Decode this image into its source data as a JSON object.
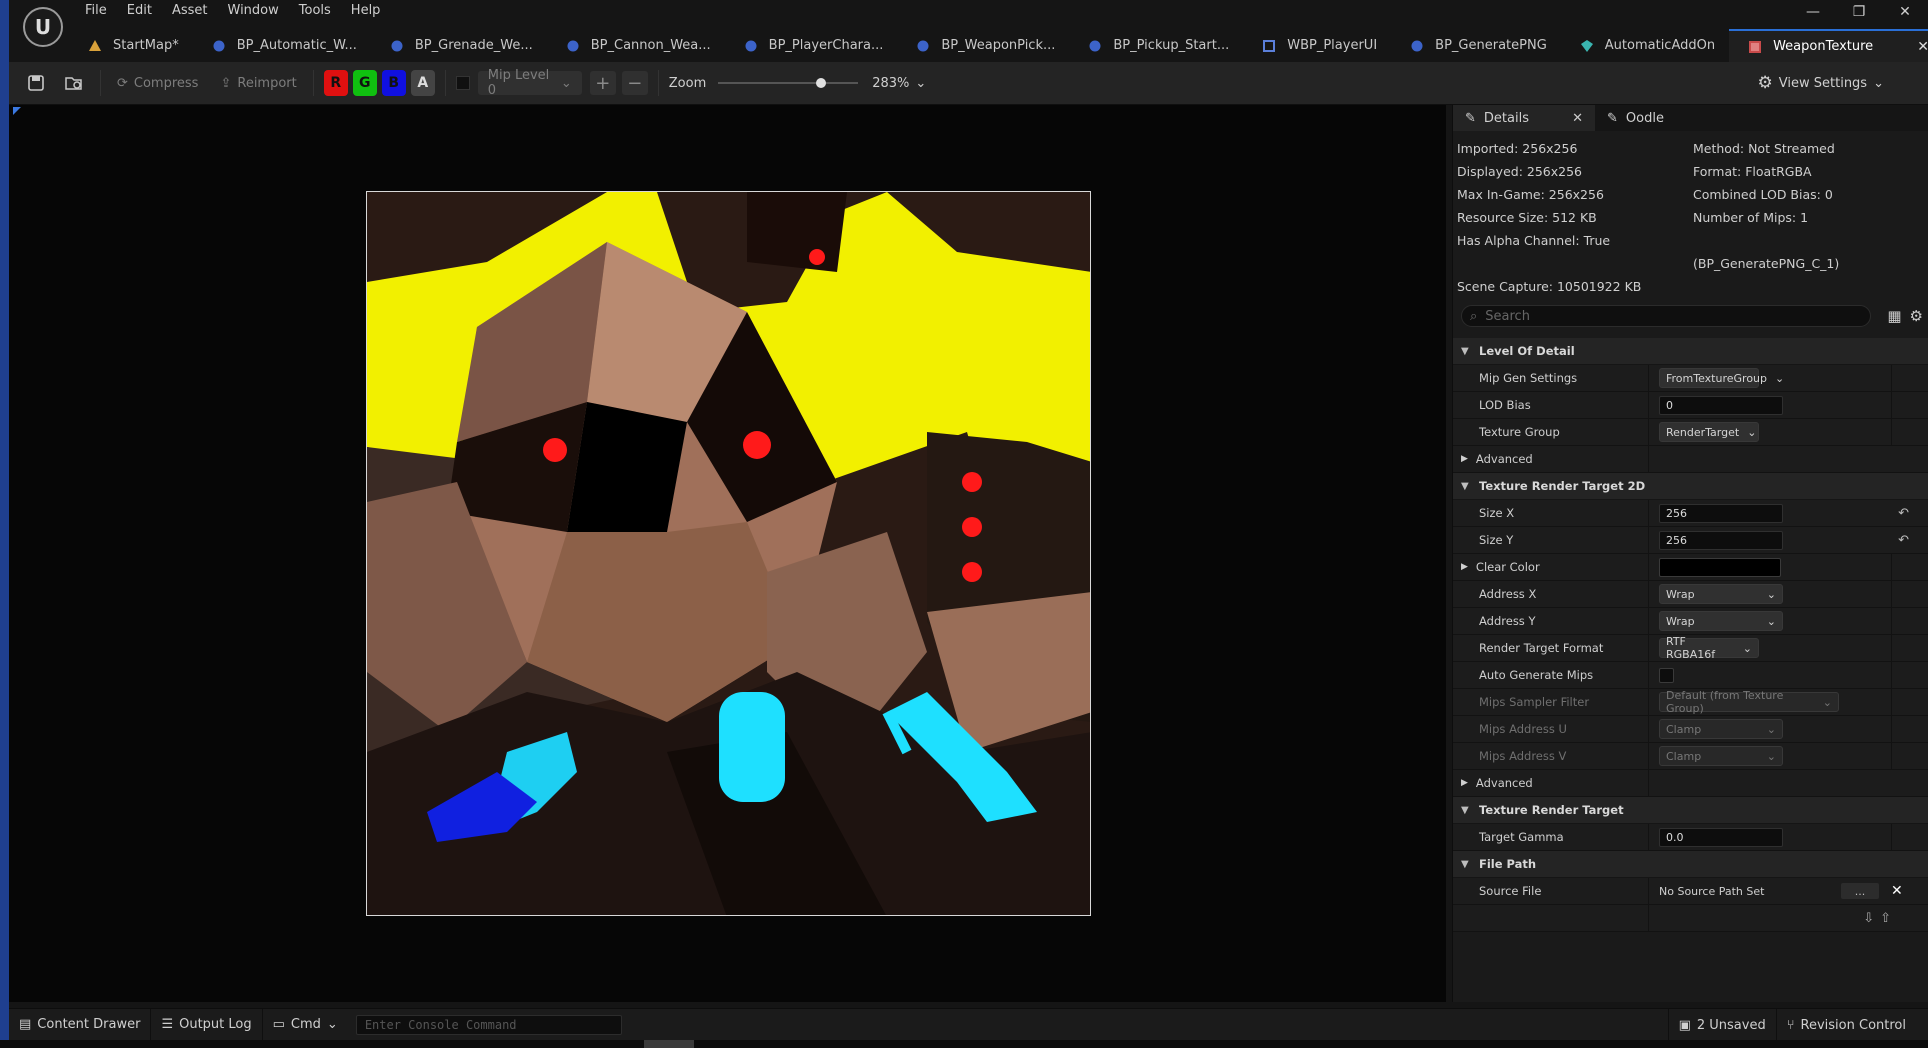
{
  "menu": [
    "File",
    "Edit",
    "Asset",
    "Window",
    "Tools",
    "Help"
  ],
  "window_controls": [
    "—",
    "❐",
    "✕"
  ],
  "tabs": [
    {
      "label": "StartMap*",
      "icon": "map-icon"
    },
    {
      "label": "BP_Automatic_W...",
      "icon": "blueprint-icon"
    },
    {
      "label": "BP_Grenade_We...",
      "icon": "blueprint-icon"
    },
    {
      "label": "BP_Cannon_Wea...",
      "icon": "blueprint-icon"
    },
    {
      "label": "BP_PlayerChara...",
      "icon": "blueprint-icon"
    },
    {
      "label": "BP_WeaponPick...",
      "icon": "blueprint-icon"
    },
    {
      "label": "BP_Pickup_Start...",
      "icon": "blueprint-icon"
    },
    {
      "label": "WBP_PlayerUI",
      "icon": "widget-blueprint-icon"
    },
    {
      "label": "BP_GeneratePNG",
      "icon": "blueprint-icon"
    },
    {
      "label": "AutomaticAddOn",
      "icon": "plugin-icon"
    },
    {
      "label": "WeaponTexture",
      "icon": "texture-icon",
      "active": true
    }
  ],
  "toolbar": {
    "compress": "Compress",
    "reimport": "Reimport",
    "channels": [
      {
        "label": "R",
        "color": "#e01010"
      },
      {
        "label": "G",
        "color": "#10c010"
      },
      {
        "label": "B",
        "color": "#1010e0"
      },
      {
        "label": "A",
        "color": "#9a9a9a"
      }
    ],
    "mip_level": "Mip Level 0",
    "zoom_label": "Zoom",
    "zoom_value": "283%",
    "zoom_fraction": 0.75,
    "view_settings": "View Settings"
  },
  "details": {
    "tab_label": "Details",
    "tab2_label": "Oodle",
    "info_left": [
      "Imported: 256x256",
      "Displayed: 256x256",
      "Max In-Game: 256x256",
      "Resource Size: 512 KB",
      "Has Alpha Channel: True"
    ],
    "info_right": [
      "Method: Not Streamed",
      "Format: FloatRGBA",
      "Combined LOD Bias: 0",
      "Number of Mips: 1"
    ],
    "info_extra": "(BP_GeneratePNG_C_1)",
    "scene_capture": "Scene Capture: 10501922 KB",
    "search_placeholder": "Search",
    "lod": {
      "title": "Level Of Detail",
      "mip_gen_label": "Mip Gen Settings",
      "mip_gen_value": "FromTextureGroup",
      "lod_bias_label": "LOD Bias",
      "lod_bias_value": "0",
      "texture_group_label": "Texture Group",
      "texture_group_value": "RenderTarget",
      "advanced": "Advanced"
    },
    "trt2d": {
      "title": "Texture Render Target 2D",
      "size_x_label": "Size X",
      "size_x_value": "256",
      "size_y_label": "Size Y",
      "size_y_value": "256",
      "clear_color_label": "Clear Color",
      "address_x_label": "Address X",
      "address_x_value": "Wrap",
      "address_y_label": "Address Y",
      "address_y_value": "Wrap",
      "rt_format_label": "Render Target Format",
      "rt_format_value": "RTF RGBA16f",
      "auto_mips_label": "Auto Generate Mips",
      "mips_filter_label": "Mips Sampler Filter",
      "mips_filter_value": "Default (from Texture Group)",
      "mips_u_label": "Mips Address U",
      "mips_u_value": "Clamp",
      "mips_v_label": "Mips Address V",
      "mips_v_value": "Clamp",
      "advanced": "Advanced"
    },
    "trt": {
      "title": "Texture Render Target",
      "gamma_label": "Target Gamma",
      "gamma_value": "0.0"
    },
    "filepath": {
      "title": "File Path",
      "source_label": "Source File",
      "source_value": "No Source Path Set",
      "browse": "..."
    }
  },
  "statusbar": {
    "content_drawer": "Content Drawer",
    "output_log": "Output Log",
    "cmd": "Cmd",
    "console_placeholder": "Enter Console Command",
    "unsaved": "2 Unsaved",
    "revision": "Revision Control"
  }
}
